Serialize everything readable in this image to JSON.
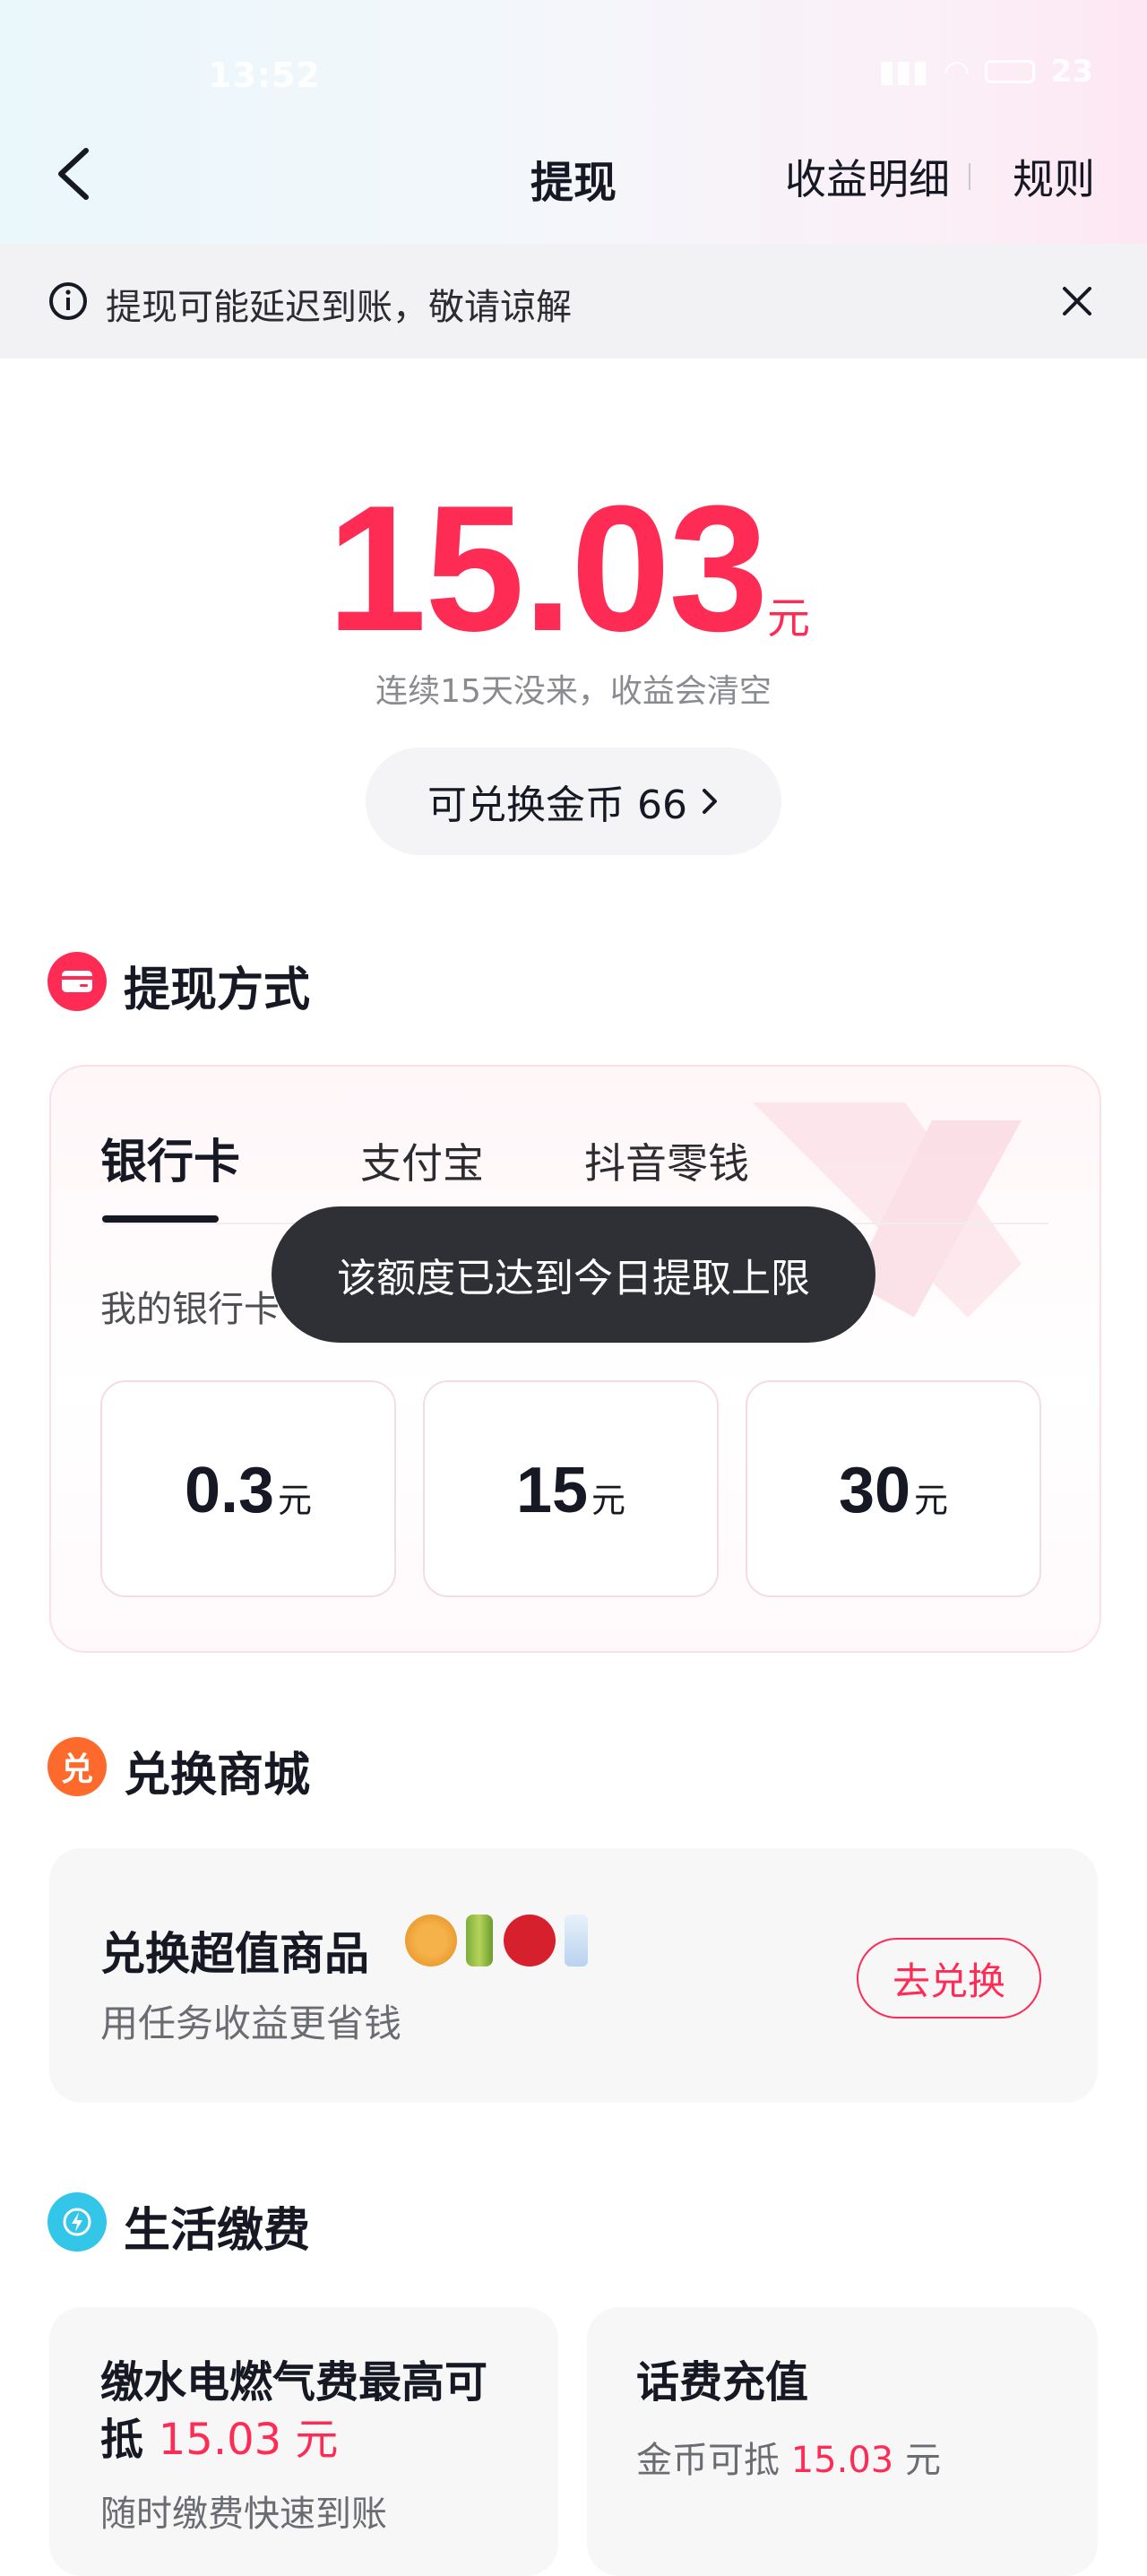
{
  "status_bar": {
    "time": "13:52",
    "battery": "23"
  },
  "nav": {
    "title": "提现",
    "detail": "收益明细",
    "rules": "规则"
  },
  "notice": {
    "text": "提现可能延迟到账，敬请谅解"
  },
  "balance": {
    "amount": "15.03",
    "unit": "元",
    "tip": "连续15天没来，收益会清空",
    "coins_label": "可兑换金币 66"
  },
  "withdraw": {
    "section_title": "提现方式",
    "tabs": [
      {
        "label": "银行卡",
        "active": true
      },
      {
        "label": "支付宝",
        "active": false
      },
      {
        "label": "抖音零钱",
        "active": false
      }
    ],
    "my_bank_label": "我的银行卡",
    "amounts": [
      {
        "value": "0.3",
        "unit": "元"
      },
      {
        "value": "15",
        "unit": "元"
      },
      {
        "value": "30",
        "unit": "元"
      }
    ],
    "toast": "该额度已达到今日提取上限"
  },
  "exchange": {
    "section_title": "兑换商城",
    "card_title": "兑换超值商品",
    "card_subtitle": "用任务收益更省钱",
    "button": "去兑换"
  },
  "life": {
    "section_title": "生活缴费",
    "utility": {
      "title_prefix": "缴水电燃气费最高可抵",
      "title_amount": "15.03 元",
      "subtitle": "随时缴费快速到账"
    },
    "phone": {
      "title": "话费充值",
      "subtitle_prefix": "金币可抵",
      "subtitle_amount": "15.03",
      "subtitle_unit": "元"
    }
  },
  "colors": {
    "accent": "#fe2c55",
    "toast_bg": "#2f3036"
  }
}
